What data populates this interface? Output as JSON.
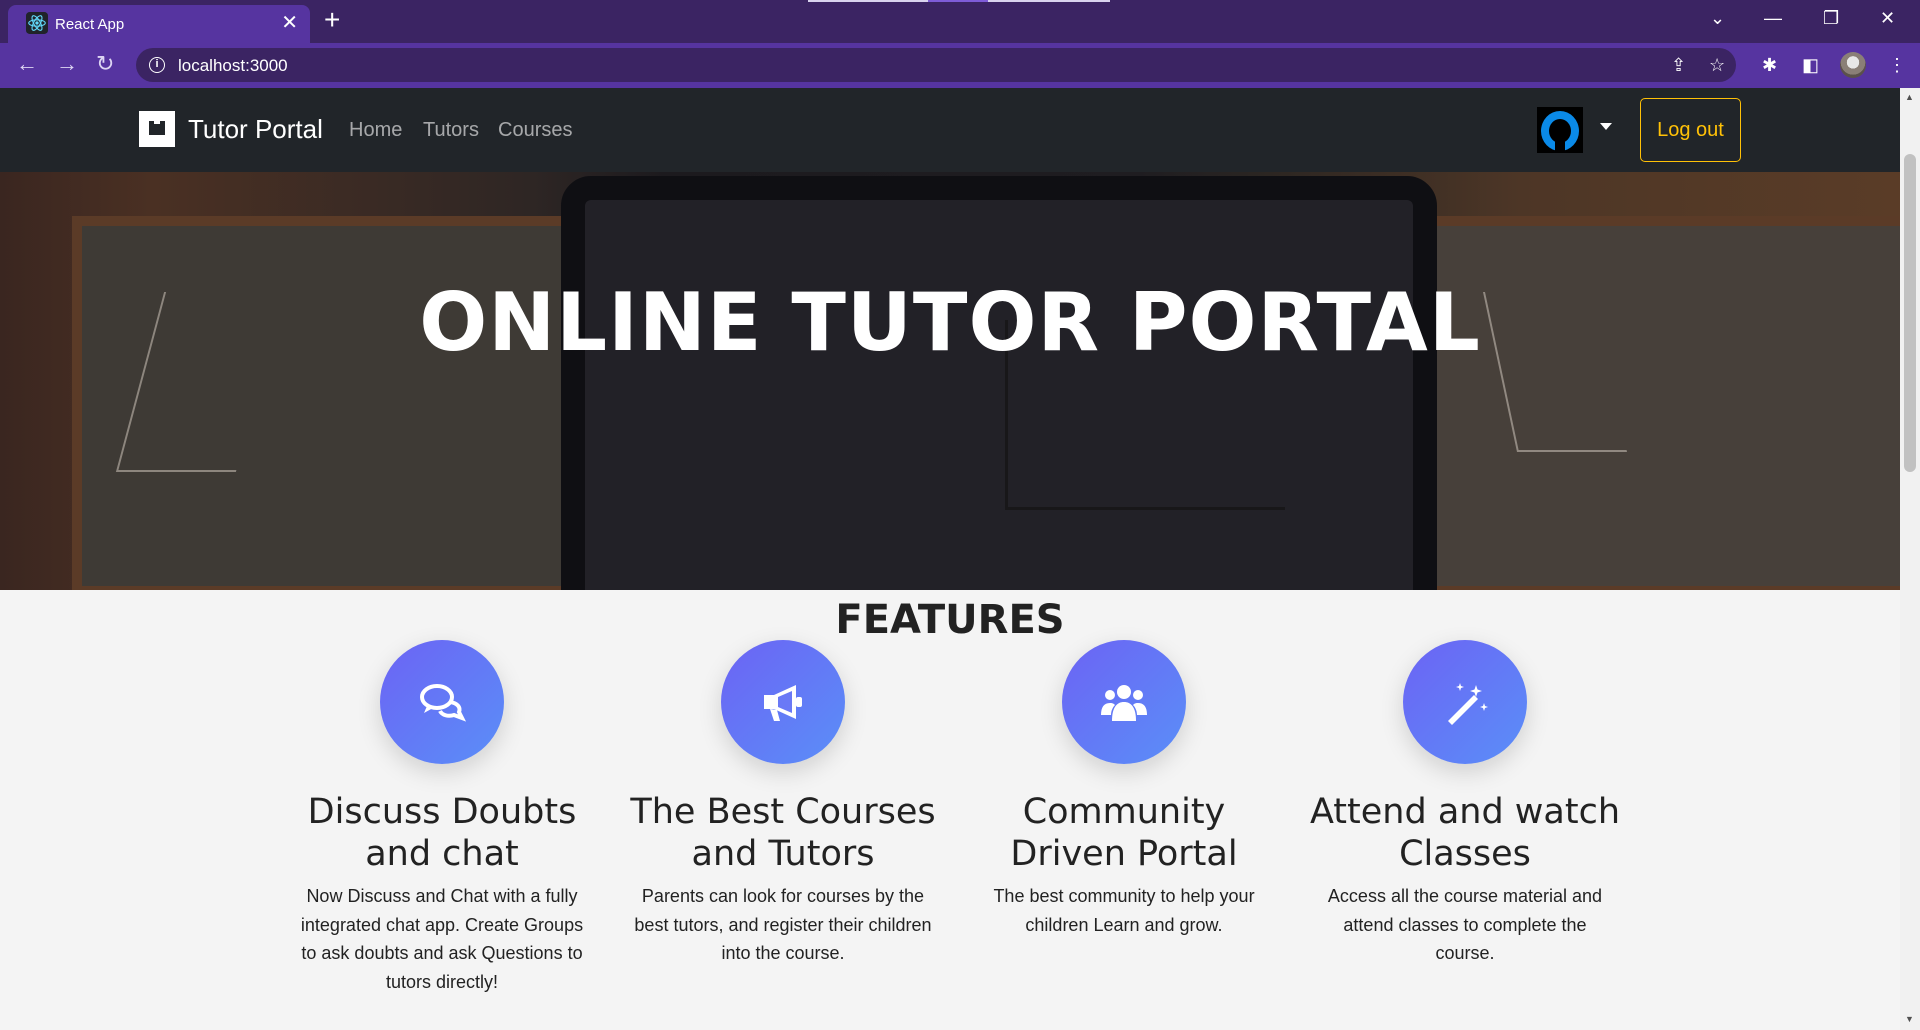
{
  "browser": {
    "tab_title": "React App",
    "tab_close": "✕",
    "new_tab": "+",
    "url": "localhost:3000",
    "window_controls": {
      "minimize": "—",
      "restore": "❐",
      "close": "✕",
      "tab_search": "⌄"
    }
  },
  "navbar": {
    "brand": "Tutor Portal",
    "links": [
      "Home",
      "Tutors",
      "Courses"
    ],
    "logout_label": "Log out"
  },
  "hero": {
    "title": "ONLINE TUTOR PORTAL"
  },
  "features": {
    "heading": "FEATURES",
    "items": [
      {
        "icon": "chat-bubbles-icon",
        "title": "Discuss Doubts and chat",
        "text": "Now Discuss and Chat with a fully integrated chat app. Create Groups to ask doubts and ask Questions to tutors directly!"
      },
      {
        "icon": "megaphone-icon",
        "title": "The Best Courses and Tutors",
        "text": "Parents can look for courses by the best tutors, and register their children into the course."
      },
      {
        "icon": "users-icon",
        "title": "Community Driven Portal",
        "text": "The best community to help your children Learn and grow."
      },
      {
        "icon": "magic-wand-icon",
        "title": "Attend and watch Classes",
        "text": "Access all the course material and attend classes to complete the course."
      }
    ]
  },
  "colors": {
    "browser_frame": "#3b2463",
    "browser_toolbar": "#5634a0",
    "navbar_bg": "#212529",
    "logout_accent": "#ffc107",
    "feature_gradient_start": "#6c63f4",
    "feature_gradient_end": "#5a8ff8"
  }
}
